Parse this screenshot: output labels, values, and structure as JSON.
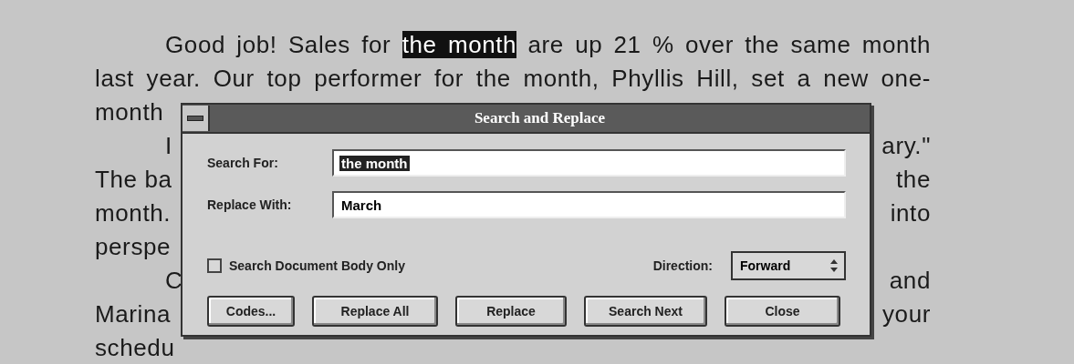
{
  "document": {
    "lines": [
      {
        "kind": "full",
        "indented": true,
        "segments": [
          {
            "text": "Good job! Sales for ",
            "selected": false
          },
          {
            "text": "the month",
            "selected": true
          },
          {
            "text": " are up 21 % over the same month",
            "selected": false
          }
        ]
      },
      {
        "kind": "full",
        "indented": false,
        "segments": [
          {
            "text": "last year. Our top performer for the month, Phyllis Hill, set a new one-",
            "selected": false
          }
        ]
      },
      {
        "kind": "split",
        "indented": false,
        "left": "month"
      },
      {
        "kind": "split",
        "indented": true,
        "left": "I",
        "right": "ary.\""
      },
      {
        "kind": "split",
        "indented": false,
        "left": "The ba",
        "right": "the"
      },
      {
        "kind": "split",
        "indented": false,
        "left": "month.",
        "right": "into"
      },
      {
        "kind": "split",
        "indented": false,
        "left": "perspe"
      },
      {
        "kind": "split",
        "indented": true,
        "left": "C",
        "right": "and"
      },
      {
        "kind": "split",
        "indented": false,
        "left": "Marina",
        "right": "your"
      },
      {
        "kind": "split",
        "indented": false,
        "left": "schedu"
      }
    ]
  },
  "dialog": {
    "title": "Search and Replace",
    "fields": [
      {
        "label": "Search For:",
        "value": "the month",
        "selected": true
      },
      {
        "label": "Replace With:",
        "value": "March",
        "selected": false
      }
    ],
    "checkbox": {
      "label": "Search Document Body Only",
      "checked": false
    },
    "direction": {
      "label": "Direction:",
      "value": "Forward"
    },
    "buttons": [
      "Codes...",
      "Replace All",
      "Replace",
      "Search Next",
      "Close"
    ]
  }
}
